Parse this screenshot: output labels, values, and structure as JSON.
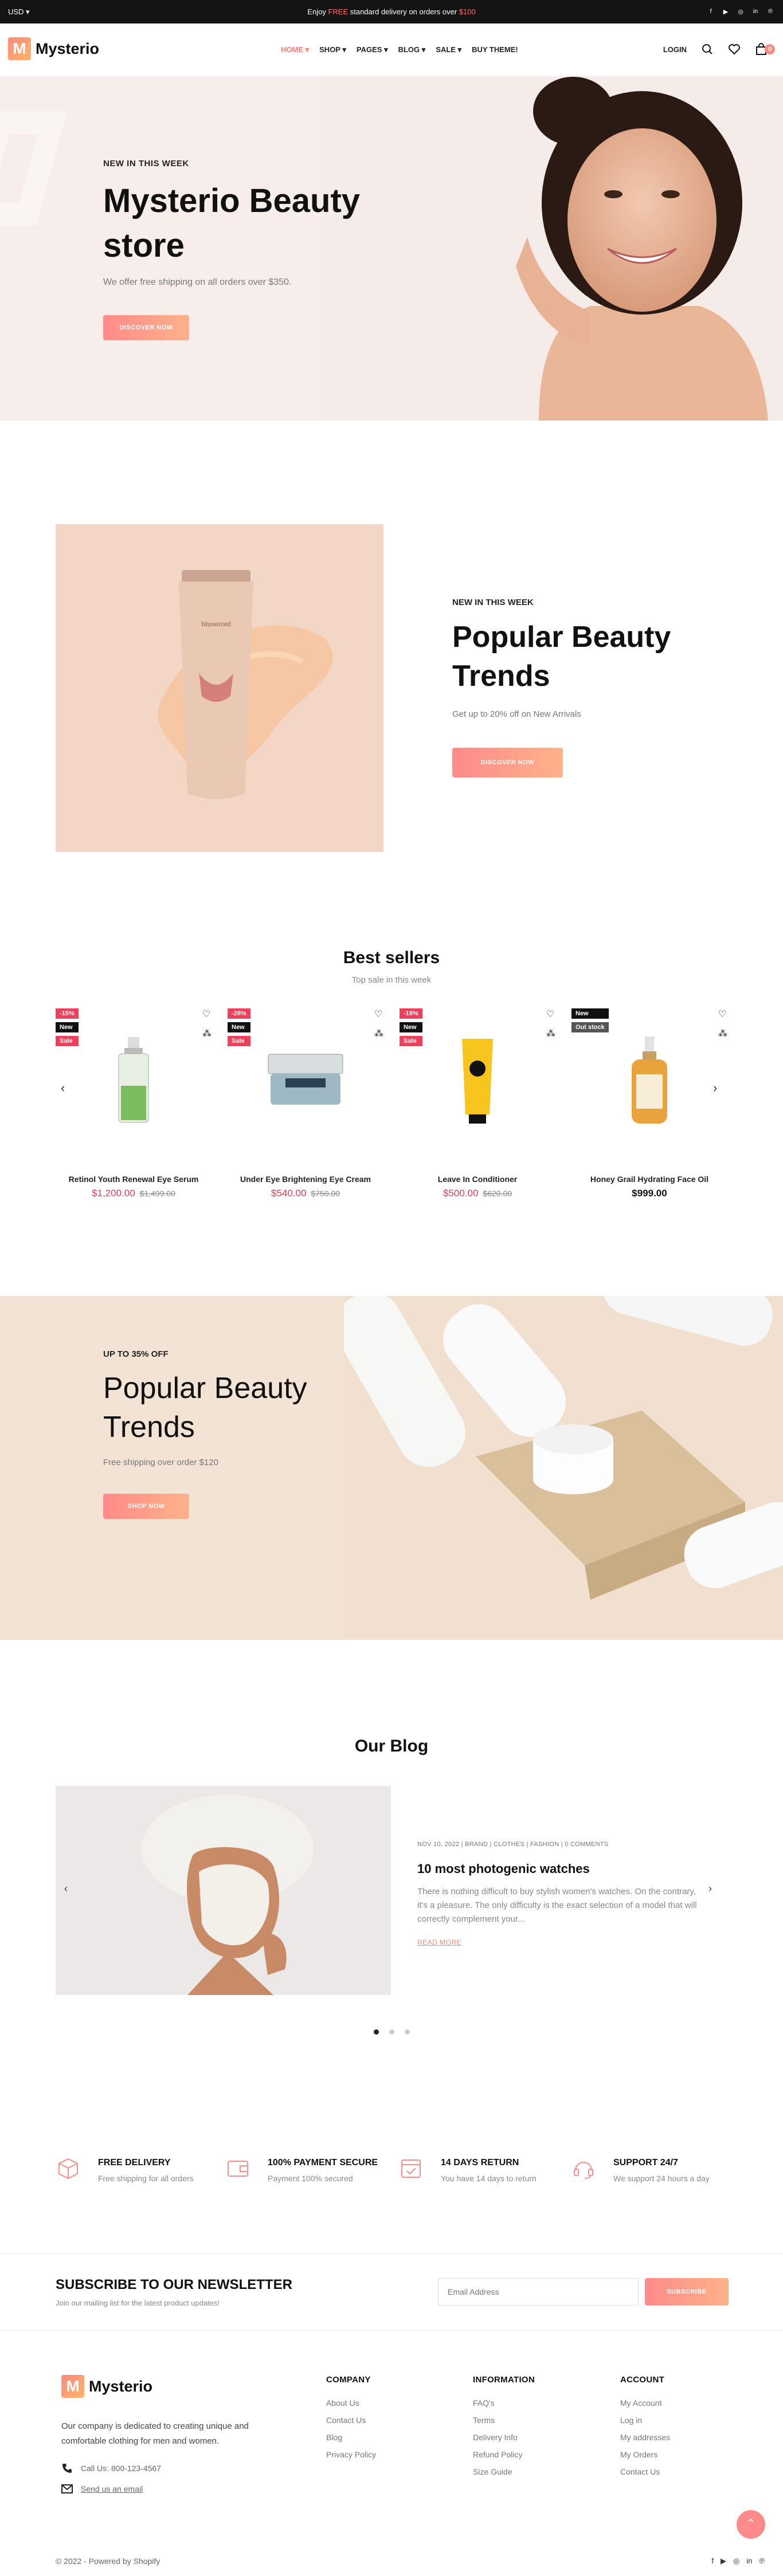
{
  "topbar": {
    "currency": "USD ▾",
    "message_pre": "Enjoy ",
    "message_free": "FREE",
    "message_mid": " standard delivery on orders over ",
    "message_amount": "$100",
    "social_icons": [
      "facebook-icon",
      "youtube-icon",
      "instagram-icon",
      "linkedin-icon",
      "pinterest-icon"
    ]
  },
  "header": {
    "logo_letter": "M",
    "logo_text": "Mysterio",
    "nav": [
      "HOME",
      "SHOP",
      "PAGES",
      "BLOG",
      "SALE",
      "BUY THEME!"
    ],
    "login": "LOGIN",
    "cart_count": "0",
    "accent": "#ff7b7b"
  },
  "hero": {
    "eyebrow": "NEW IN THIS WEEK",
    "title": "Mysterio Beauty store",
    "subtitle": "We offer free shipping on all orders over $350.",
    "button": "DISCOVER NOW"
  },
  "trend": {
    "eyebrow": "NEW IN THIS WEEK",
    "title": "Popular Beauty Trends",
    "subtitle": "Get up to 20% off on New Arrivals",
    "button": "DISCOVER NOW",
    "tube_brand": "blusstrotd"
  },
  "bestsellers": {
    "title": "Best sellers",
    "subtitle": "Top sale in this week",
    "products": [
      {
        "badges": [
          "-15%",
          "New",
          "Sale"
        ],
        "name": "Retinol Youth Renewal Eye Serum",
        "price": "$1,200.00",
        "old_price": "$1,499.00"
      },
      {
        "badges": [
          "-28%",
          "New",
          "Sale"
        ],
        "name": "Under Eye Brightening Eye Cream",
        "price": "$540.00",
        "old_price": "$750.00"
      },
      {
        "badges": [
          "-19%",
          "New",
          "Sale"
        ],
        "name": "Leave In Conditioner",
        "price": "$500.00",
        "old_price": "$620.00"
      },
      {
        "badges": [
          "New",
          "Out stock"
        ],
        "name": "Honey Grail Hydrating Face Oil",
        "price": "$999.00",
        "old_price": ""
      }
    ]
  },
  "banner2": {
    "eyebrow": "UP TO 35% OFF",
    "title": "Popular Beauty Trends",
    "subtitle": "Free shipping over order $120",
    "button": "SHOP NOW"
  },
  "blog": {
    "title": "Our Blog",
    "meta": "NOV 10, 2022 | BRAND | CLOTHES | FASHION | 0 COMMENTS",
    "post_title": "10 most photogenic watches",
    "excerpt": "There is nothing difficult to buy stylish women's watches. On the contrary, it's a pleasure. The only difficulty is the exact selection of a model that will correctly complement your...",
    "read_more": "READ MORE"
  },
  "features": [
    {
      "icon": "package-icon",
      "title": "FREE DELIVERY",
      "desc": "Free shipping for all orders"
    },
    {
      "icon": "wallet-icon",
      "title": "100% PAYMENT SECURE",
      "desc": "Payment 100% secured"
    },
    {
      "icon": "calendar-check-icon",
      "title": "14 DAYS RETURN",
      "desc": "You have 14 days to return"
    },
    {
      "icon": "headset-icon",
      "title": "SUPPORT 24/7",
      "desc": "We support 24 hours a day"
    }
  ],
  "newsletter": {
    "title": "SUBSCRIBE TO OUR NEWSLETTER",
    "subtitle": "Join our mailing list for the latest product updates!",
    "placeholder": "Email Address",
    "button": "SUBSCRIBE"
  },
  "footer": {
    "about": "Our company is dedicated to creating unique and comfortable clothing for men and women.",
    "phone": "Call Us: 800-123-4567",
    "email": "Send us an email",
    "company": {
      "title": "COMPANY",
      "links": [
        "About Us",
        "Contact Us",
        "Blog",
        "Privacy Policy"
      ]
    },
    "information": {
      "title": "INFORMATION",
      "links": [
        "FAQ's",
        "Terms",
        "Delivery Info",
        "Refund Policy",
        "Size Guide"
      ]
    },
    "account": {
      "title": "ACCOUNT",
      "links": [
        "My Account",
        "Log in",
        "My addresses",
        "My Orders",
        "Contact Us"
      ]
    },
    "copyright": "© 2022 - Powered by Shopify"
  }
}
